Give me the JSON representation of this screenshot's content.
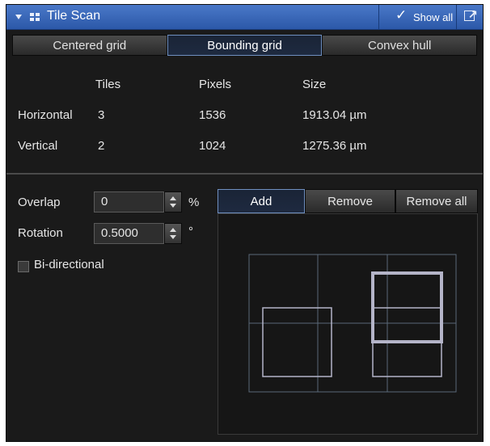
{
  "header": {
    "title": "Tile Scan",
    "show_all": "Show all"
  },
  "tabs": [
    {
      "label": "Centered grid",
      "active": false
    },
    {
      "label": "Bounding grid",
      "active": true
    },
    {
      "label": "Convex hull",
      "active": false
    }
  ],
  "table": {
    "columns": [
      "Tiles",
      "Pixels",
      "Size"
    ],
    "rows": [
      {
        "label": "Horizontal",
        "tiles": "3",
        "pixels": "1536",
        "size": "1913.04 µm"
      },
      {
        "label": "Vertical",
        "tiles": "2",
        "pixels": "1024",
        "size": "1275.36 µm"
      }
    ]
  },
  "settings": {
    "overlap": {
      "label": "Overlap",
      "value": "0",
      "unit": "%"
    },
    "rotation": {
      "label": "Rotation",
      "value": "0.5000",
      "unit": "°"
    },
    "bidirectional": {
      "label": "Bi-directional",
      "checked": false
    }
  },
  "actions": {
    "add": "Add",
    "remove": "Remove",
    "remove_all": "Remove all"
  },
  "colors": {
    "title_bar": "#3a66b8",
    "panel_bg": "#1a1a1a",
    "active_border": "#6f8fbf",
    "tile_outline": "#b4b4c8",
    "grid_line": "#5a6878"
  }
}
